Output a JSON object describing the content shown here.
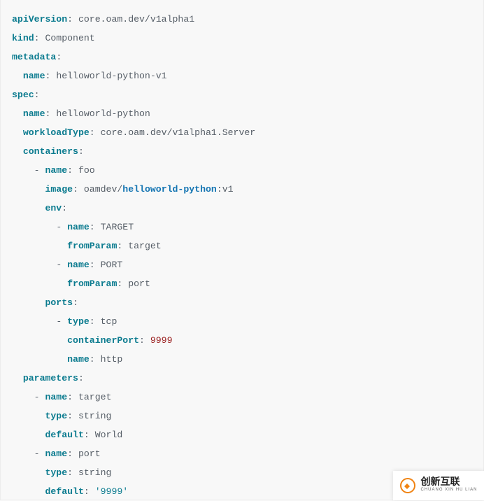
{
  "code": {
    "lines": [
      [
        {
          "c": "key",
          "t": "apiVersion"
        },
        {
          "c": "punct",
          "t": ": "
        },
        {
          "c": "str",
          "t": "core.oam.dev/v1alpha1"
        }
      ],
      [
        {
          "c": "key",
          "t": "kind"
        },
        {
          "c": "punct",
          "t": ": "
        },
        {
          "c": "str",
          "t": "Component"
        }
      ],
      [
        {
          "c": "key",
          "t": "metadata"
        },
        {
          "c": "punct",
          "t": ":"
        }
      ],
      [
        {
          "c": "punct",
          "t": "  "
        },
        {
          "c": "key",
          "t": "name"
        },
        {
          "c": "punct",
          "t": ": "
        },
        {
          "c": "str",
          "t": "helloworld-python-v1"
        }
      ],
      [
        {
          "c": "key",
          "t": "spec"
        },
        {
          "c": "punct",
          "t": ":"
        }
      ],
      [
        {
          "c": "punct",
          "t": "  "
        },
        {
          "c": "key",
          "t": "name"
        },
        {
          "c": "punct",
          "t": ": "
        },
        {
          "c": "str",
          "t": "helloworld-python"
        }
      ],
      [
        {
          "c": "punct",
          "t": "  "
        },
        {
          "c": "key",
          "t": "workloadType"
        },
        {
          "c": "punct",
          "t": ": "
        },
        {
          "c": "str",
          "t": "core.oam.dev/v1alpha1.Server"
        }
      ],
      [
        {
          "c": "punct",
          "t": "  "
        },
        {
          "c": "key",
          "t": "containers"
        },
        {
          "c": "punct",
          "t": ":"
        }
      ],
      [
        {
          "c": "punct",
          "t": "    "
        },
        {
          "c": "dash",
          "t": "- "
        },
        {
          "c": "key",
          "t": "name"
        },
        {
          "c": "punct",
          "t": ": "
        },
        {
          "c": "str",
          "t": "foo"
        }
      ],
      [
        {
          "c": "punct",
          "t": "      "
        },
        {
          "c": "key",
          "t": "image"
        },
        {
          "c": "punct",
          "t": ": "
        },
        {
          "c": "str",
          "t": "oamdev/"
        },
        {
          "c": "strB",
          "t": "helloworld-python"
        },
        {
          "c": "punct",
          "t": ":"
        },
        {
          "c": "str",
          "t": "v1"
        }
      ],
      [
        {
          "c": "punct",
          "t": "      "
        },
        {
          "c": "key",
          "t": "env"
        },
        {
          "c": "punct",
          "t": ":"
        }
      ],
      [
        {
          "c": "punct",
          "t": "        "
        },
        {
          "c": "dash",
          "t": "- "
        },
        {
          "c": "key",
          "t": "name"
        },
        {
          "c": "punct",
          "t": ": "
        },
        {
          "c": "str",
          "t": "TARGET"
        }
      ],
      [
        {
          "c": "punct",
          "t": "          "
        },
        {
          "c": "key",
          "t": "fromParam"
        },
        {
          "c": "punct",
          "t": ": "
        },
        {
          "c": "str",
          "t": "target"
        }
      ],
      [
        {
          "c": "punct",
          "t": "        "
        },
        {
          "c": "dash",
          "t": "- "
        },
        {
          "c": "key",
          "t": "name"
        },
        {
          "c": "punct",
          "t": ": "
        },
        {
          "c": "str",
          "t": "PORT"
        }
      ],
      [
        {
          "c": "punct",
          "t": "          "
        },
        {
          "c": "key",
          "t": "fromParam"
        },
        {
          "c": "punct",
          "t": ": "
        },
        {
          "c": "str",
          "t": "port"
        }
      ],
      [
        {
          "c": "punct",
          "t": "      "
        },
        {
          "c": "key",
          "t": "ports"
        },
        {
          "c": "punct",
          "t": ":"
        }
      ],
      [
        {
          "c": "punct",
          "t": "        "
        },
        {
          "c": "dash",
          "t": "- "
        },
        {
          "c": "key",
          "t": "type"
        },
        {
          "c": "punct",
          "t": ": "
        },
        {
          "c": "str",
          "t": "tcp"
        }
      ],
      [
        {
          "c": "punct",
          "t": "          "
        },
        {
          "c": "key",
          "t": "containerPort"
        },
        {
          "c": "punct",
          "t": ": "
        },
        {
          "c": "num",
          "t": "9999"
        }
      ],
      [
        {
          "c": "punct",
          "t": "          "
        },
        {
          "c": "key",
          "t": "name"
        },
        {
          "c": "punct",
          "t": ": "
        },
        {
          "c": "str",
          "t": "http"
        }
      ],
      [
        {
          "c": "punct",
          "t": "  "
        },
        {
          "c": "key",
          "t": "parameters"
        },
        {
          "c": "punct",
          "t": ":"
        }
      ],
      [
        {
          "c": "punct",
          "t": "    "
        },
        {
          "c": "dash",
          "t": "- "
        },
        {
          "c": "key",
          "t": "name"
        },
        {
          "c": "punct",
          "t": ": "
        },
        {
          "c": "str",
          "t": "target"
        }
      ],
      [
        {
          "c": "punct",
          "t": "      "
        },
        {
          "c": "key",
          "t": "type"
        },
        {
          "c": "punct",
          "t": ": "
        },
        {
          "c": "str",
          "t": "string"
        }
      ],
      [
        {
          "c": "punct",
          "t": "      "
        },
        {
          "c": "key",
          "t": "default"
        },
        {
          "c": "punct",
          "t": ": "
        },
        {
          "c": "str",
          "t": "World"
        }
      ],
      [
        {
          "c": "punct",
          "t": "    "
        },
        {
          "c": "dash",
          "t": "- "
        },
        {
          "c": "key",
          "t": "name"
        },
        {
          "c": "punct",
          "t": ": "
        },
        {
          "c": "str",
          "t": "port"
        }
      ],
      [
        {
          "c": "punct",
          "t": "      "
        },
        {
          "c": "key",
          "t": "type"
        },
        {
          "c": "punct",
          "t": ": "
        },
        {
          "c": "str",
          "t": "string"
        }
      ],
      [
        {
          "c": "punct",
          "t": "      "
        },
        {
          "c": "key",
          "t": "default"
        },
        {
          "c": "punct",
          "t": ": "
        },
        {
          "c": "quoted",
          "t": "'9999'"
        }
      ]
    ]
  },
  "logo": {
    "chinese": "创新互联",
    "pinyin": "CHUANG XIN HU LIAN"
  }
}
